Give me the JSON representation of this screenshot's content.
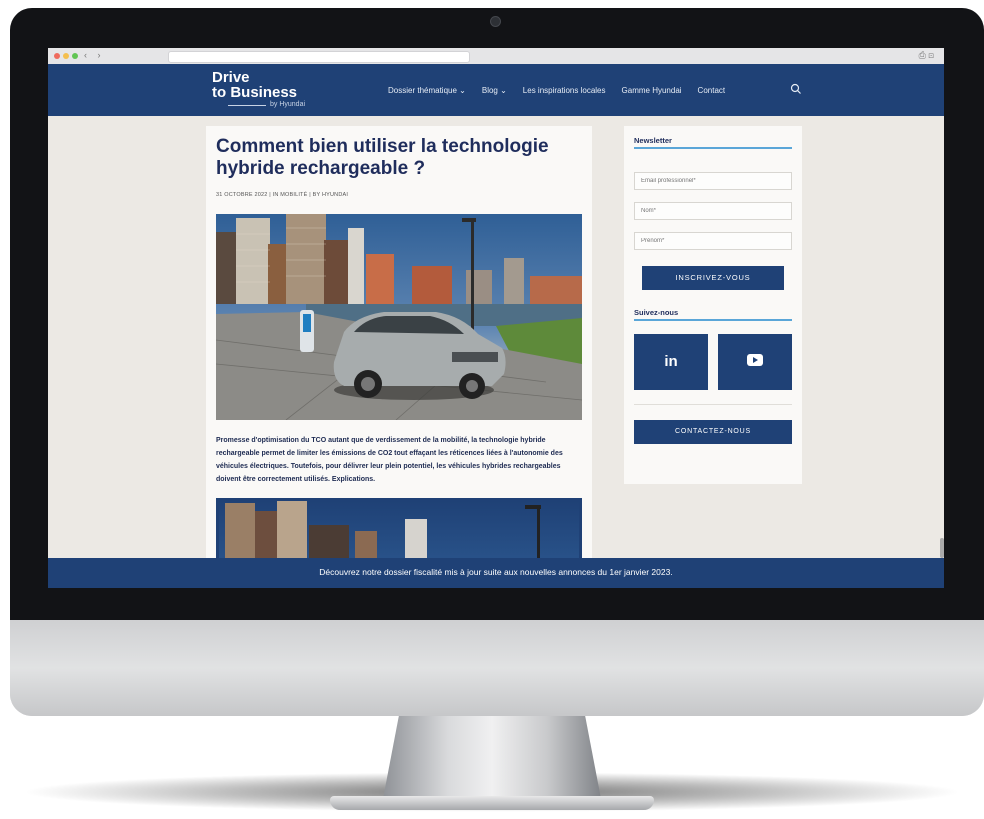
{
  "browser": {
    "nav_arrows": "‹ ›",
    "window_icons": "⎙ ⊡"
  },
  "site": {
    "logo_line1": "Drive",
    "logo_line2": "to Business",
    "logo_by": "by Hyundai",
    "nav": [
      {
        "label": "Dossier thématique ⌄"
      },
      {
        "label": "Blog ⌄"
      },
      {
        "label": "Les inspirations locales"
      },
      {
        "label": "Gamme Hyundai"
      },
      {
        "label": "Contact"
      }
    ],
    "search_icon": "search-icon"
  },
  "article": {
    "title": "Comment bien utiliser la technologie hybride rechargeable ?",
    "meta": "31 OCTOBRE 2022  |  IN MOBILITÉ  |  BY HYUNDAI",
    "excerpt": "Promesse d'optimisation du TCO autant que de verdissement de la mobilité, la technologie hybride rechargeable permet de limiter les émissions de CO2 tout effaçant les réticences liées à l'autonomie des véhicules électriques. Toutefois, pour délivrer leur plein potentiel, les véhicules hybrides rechargeables doivent être correctement utilisés. Explications."
  },
  "sidebar": {
    "newsletter_heading": "Newsletter",
    "email_placeholder": "Email professionnel*",
    "nom_placeholder": "Nom*",
    "prenom_placeholder": "Prénom*",
    "subscribe_label": "INSCRIVEZ-VOUS",
    "follow_heading": "Suivez-nous",
    "linkedin_label": "in",
    "contact_label": "CONTACTEZ-NOUS"
  },
  "banner": {
    "text": "Découvrez notre dossier fiscalité mis à jour suite aux nouvelles annonces du 1er janvier 2023."
  },
  "colors": {
    "brand_navy": "#1f4176",
    "accent_blue": "#5aa6d8",
    "title_navy": "#1f2d5c"
  }
}
